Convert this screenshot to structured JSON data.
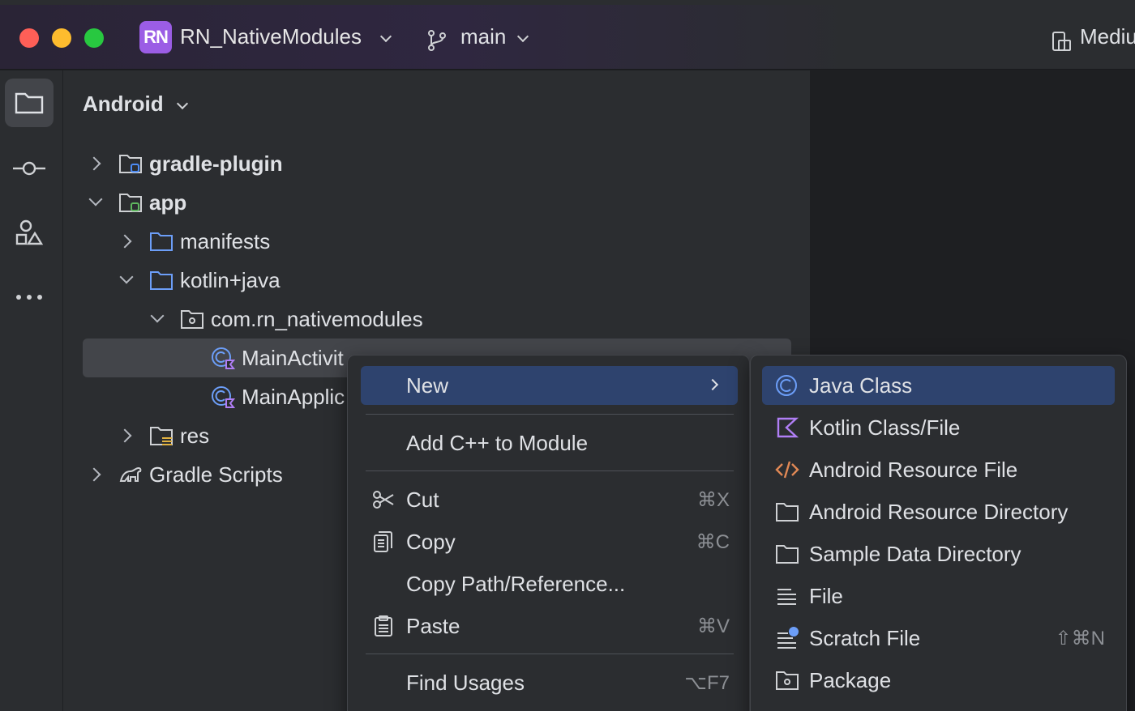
{
  "titlebar": {
    "project_badge": "RN",
    "project_name": "RN_NativeModules",
    "branch": "main",
    "right_widget": "Mediu"
  },
  "toolstrip": {
    "items": [
      "project-icon",
      "commit-icon",
      "structure-icon",
      "more-icon"
    ]
  },
  "project_panel": {
    "view_mode": "Android",
    "tree": [
      {
        "label": "gradle-plugin",
        "icon": "module-folder-icon",
        "bold": true,
        "expanded": false
      },
      {
        "label": "app",
        "icon": "module-folder-icon",
        "bold": true,
        "expanded": true
      },
      {
        "label": "manifests",
        "icon": "folder-icon",
        "expanded": false
      },
      {
        "label": "kotlin+java",
        "icon": "folder-icon",
        "expanded": true
      },
      {
        "label": "com.rn_nativemodules",
        "icon": "package-icon",
        "expanded": true
      },
      {
        "label": "MainActivity",
        "icon": "kotlin-class-icon",
        "selected": true
      },
      {
        "label": "MainApplic",
        "icon": "kotlin-class-icon"
      },
      {
        "label": "res",
        "icon": "resource-folder-icon",
        "expanded": false
      },
      {
        "label": "Gradle Scripts",
        "icon": "gradle-icon",
        "expanded": false
      }
    ],
    "selected_label": "MainActivit"
  },
  "context_menu": {
    "items": [
      {
        "label": "New",
        "has_submenu": true
      },
      {
        "label": "Add C++ to Module"
      },
      {
        "label": "Cut",
        "shortcut": "⌘X"
      },
      {
        "label": "Copy",
        "shortcut": "⌘C"
      },
      {
        "label": "Copy Path/Reference..."
      },
      {
        "label": "Paste",
        "shortcut": "⌘V"
      },
      {
        "label": "Find Usages",
        "shortcut": "⌥F7"
      }
    ]
  },
  "new_submenu": {
    "items": [
      {
        "label": "Java Class",
        "icon": "java-class-icon"
      },
      {
        "label": "Kotlin Class/File",
        "icon": "kotlin-icon"
      },
      {
        "label": "Android Resource File",
        "icon": "xml-icon"
      },
      {
        "label": "Android Resource Directory",
        "icon": "folder-icon"
      },
      {
        "label": "Sample Data Directory",
        "icon": "folder-icon"
      },
      {
        "label": "File",
        "icon": "file-icon"
      },
      {
        "label": "Scratch File",
        "icon": "scratch-file-icon",
        "shortcut": "⇧⌘N"
      },
      {
        "label": "Package",
        "icon": "package-icon"
      }
    ]
  },
  "colors": {
    "accent_highlight": "#2e436e",
    "project_badge": "#9b5de5",
    "panel_bg": "#2b2d30",
    "editor_bg": "#1e1f22"
  }
}
